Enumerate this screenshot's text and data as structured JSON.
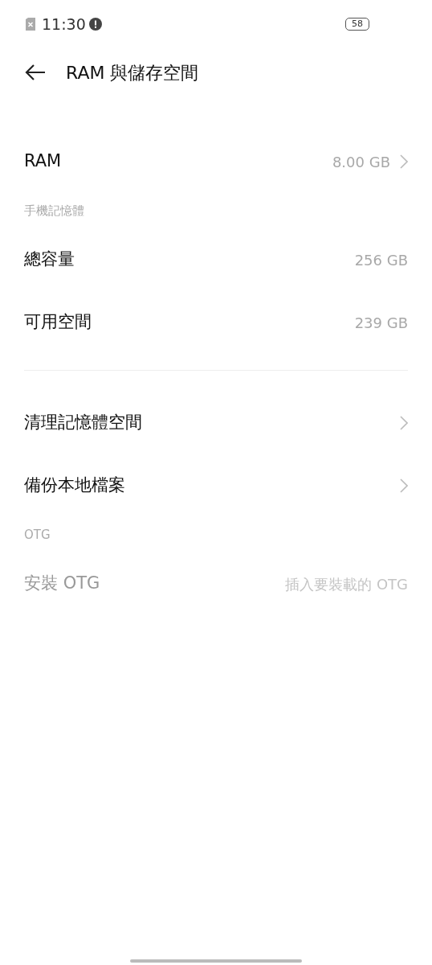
{
  "status_bar": {
    "time": "11:30",
    "battery": "58"
  },
  "header": {
    "title": "RAM 與儲存空間"
  },
  "groups": [
    {
      "items": [
        {
          "label": "RAM",
          "value": "8.00 GB",
          "chevron": true,
          "disabled": false
        }
      ]
    },
    {
      "header": "手機記憶體",
      "items": [
        {
          "label": "總容量",
          "value": "256 GB",
          "chevron": false,
          "disabled": false
        },
        {
          "label": "可用空間",
          "value": "239 GB",
          "chevron": false,
          "disabled": false
        }
      ]
    },
    {
      "items": [
        {
          "label": "清理記憶體空間",
          "chevron": true,
          "disabled": false
        },
        {
          "label": "備份本地檔案",
          "chevron": true,
          "disabled": false
        }
      ]
    },
    {
      "header": "OTG",
      "items": [
        {
          "label": "安裝 OTG",
          "value": "插入要裝載的 OTG",
          "chevron": false,
          "disabled": true
        }
      ]
    }
  ]
}
